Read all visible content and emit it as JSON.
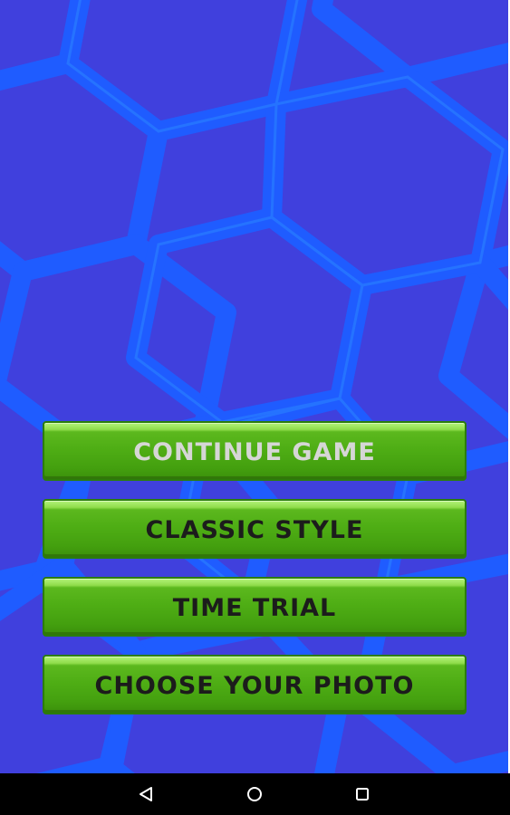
{
  "colors": {
    "background": "#4040dd",
    "hex_lines": "#1f5cff",
    "button_green": "#4fae15",
    "disabled_text": "#d6d6d6",
    "button_text": "#1c1c1c",
    "nav_bar": "#000000"
  },
  "menu": {
    "items": [
      {
        "label": "CONTINUE GAME",
        "state": "disabled"
      },
      {
        "label": "CLASSIC STYLE",
        "state": "enabled"
      },
      {
        "label": "TIME TRIAL",
        "state": "enabled"
      },
      {
        "label": "CHOOSE YOUR PHOTO",
        "state": "enabled"
      }
    ]
  },
  "nav_bar": {
    "buttons": [
      {
        "icon": "back-icon"
      },
      {
        "icon": "home-icon"
      },
      {
        "icon": "recents-icon"
      }
    ]
  }
}
